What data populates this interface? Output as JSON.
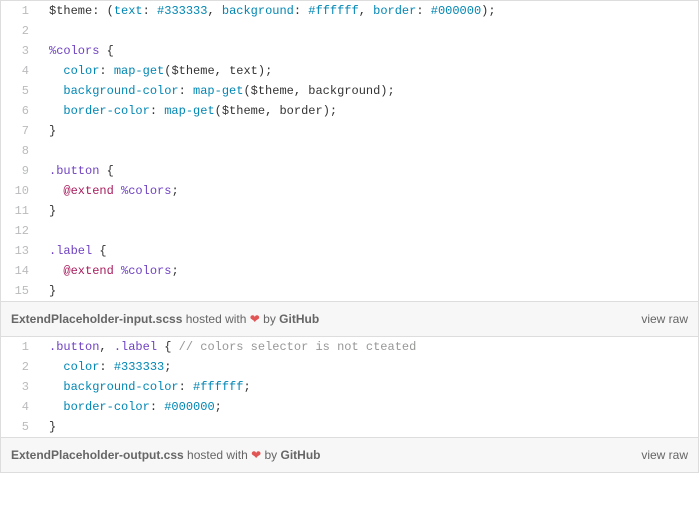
{
  "gist1": {
    "filename": "ExtendPlaceholder-input.scss",
    "hosted_text": " hosted with ",
    "heart": "❤",
    "by_text": " by ",
    "host": "GitHub",
    "view_raw": "view raw",
    "lines": {
      "n1": "1",
      "n2": "2",
      "n3": "3",
      "n4": "4",
      "n5": "5",
      "n6": "6",
      "n7": "7",
      "n8": "8",
      "n9": "9",
      "n10": "10",
      "n11": "11",
      "n12": "12",
      "n13": "13",
      "n14": "14",
      "n15": "15"
    },
    "code": {
      "l1": {
        "a": "$theme",
        "b": ": (",
        "c": "text",
        "d": ": ",
        "e": "#333333",
        "f": ", ",
        "g": "background",
        "h": ": ",
        "i": "#ffffff",
        "j": ", ",
        "k": "border",
        "l": ": ",
        "m": "#000000",
        "n": ");"
      },
      "l3": {
        "a": "%colors",
        "b": " {"
      },
      "l4": {
        "pad": "  ",
        "a": "color",
        "b": ": ",
        "c": "map-get",
        "d": "(",
        "e": "$theme",
        "f": ", ",
        "g": "text",
        "h": ");"
      },
      "l5": {
        "pad": "  ",
        "a": "background-color",
        "b": ": ",
        "c": "map-get",
        "d": "(",
        "e": "$theme",
        "f": ", ",
        "g": "background",
        "h": ");"
      },
      "l6": {
        "pad": "  ",
        "a": "border-color",
        "b": ": ",
        "c": "map-get",
        "d": "(",
        "e": "$theme",
        "f": ", ",
        "g": "border",
        "h": ");"
      },
      "l7": {
        "a": "}"
      },
      "l9": {
        "a": ".button",
        "b": " {"
      },
      "l10": {
        "pad": "  ",
        "a": "@extend",
        "b": " ",
        "c": "%colors",
        "d": ";"
      },
      "l11": {
        "a": "}"
      },
      "l13": {
        "a": ".label",
        "b": " {"
      },
      "l14": {
        "pad": "  ",
        "a": "@extend",
        "b": " ",
        "c": "%colors",
        "d": ";"
      },
      "l15": {
        "a": "}"
      }
    }
  },
  "gist2": {
    "filename": "ExtendPlaceholder-output.css",
    "hosted_text": " hosted with ",
    "heart": "❤",
    "by_text": " by ",
    "host": "GitHub",
    "view_raw": "view raw",
    "lines": {
      "n1": "1",
      "n2": "2",
      "n3": "3",
      "n4": "4",
      "n5": "5"
    },
    "code": {
      "l1": {
        "a": ".button",
        "b": ", ",
        "c": ".label",
        "d": " { ",
        "e": "// colors selector is not cteated"
      },
      "l2": {
        "pad": "  ",
        "a": "color",
        "b": ": ",
        "c": "#333333",
        "d": ";"
      },
      "l3": {
        "pad": "  ",
        "a": "background-color",
        "b": ": ",
        "c": "#ffffff",
        "d": ";"
      },
      "l4": {
        "pad": "  ",
        "a": "border-color",
        "b": ": ",
        "c": "#000000",
        "d": ";"
      },
      "l5": {
        "a": "}"
      }
    }
  }
}
